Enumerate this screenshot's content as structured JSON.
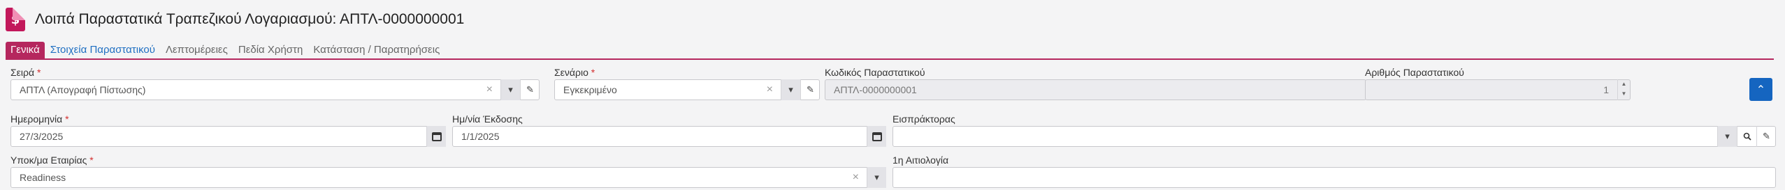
{
  "header": {
    "icon": "dollar-document-icon",
    "icon_glyph": "$",
    "title": "Λοιπά Παραστατικά Τραπεζικού Λογαριασμού: ΑΠΤΛ-0000000001"
  },
  "tabs": [
    {
      "label": "Γενικά",
      "active": true
    },
    {
      "label": "Στοιχεία Παραστατικού",
      "link": true
    },
    {
      "label": "Λεπτομέρειες"
    },
    {
      "label": "Πεδία Χρήστη"
    },
    {
      "label": "Κατάσταση / Παρατηρήσεις"
    }
  ],
  "fields": {
    "series": {
      "label": "Σειρά",
      "required": "*",
      "value": "ΑΠΤΛ (Απογραφή Πίστωσης)"
    },
    "scenario": {
      "label": "Σενάριο",
      "required": "*",
      "value": "Εγκεκριμένο"
    },
    "doc_code": {
      "label": "Κωδικός Παραστατικού",
      "value": "ΑΠΤΛ-0000000001"
    },
    "doc_number": {
      "label": "Αριθμός Παραστατικού",
      "value": "1"
    },
    "date": {
      "label": "Ημερομηνία",
      "required": "*",
      "value": "27/3/2025"
    },
    "issue_date": {
      "label": "Ημ/νία Έκδοσης",
      "value": "1/1/2025"
    },
    "collector": {
      "label": "Εισπράκτορας",
      "value": ""
    },
    "company_branch": {
      "label": "Υποκ/μα Εταιρίας",
      "required": "*",
      "value": "Readiness"
    },
    "reason1": {
      "label": "1η Αιτιολογία",
      "value": ""
    }
  },
  "glyphs": {
    "clear": "×",
    "dropdown": "▾",
    "edit": "✎",
    "search": "🔍",
    "spin_up": "▲",
    "spin_down": "▼",
    "collapse": "⌃"
  },
  "colors": {
    "accent": "#b5275e",
    "link": "#1f6fc2",
    "primary": "#1565c0",
    "required": "#d32f2f"
  }
}
